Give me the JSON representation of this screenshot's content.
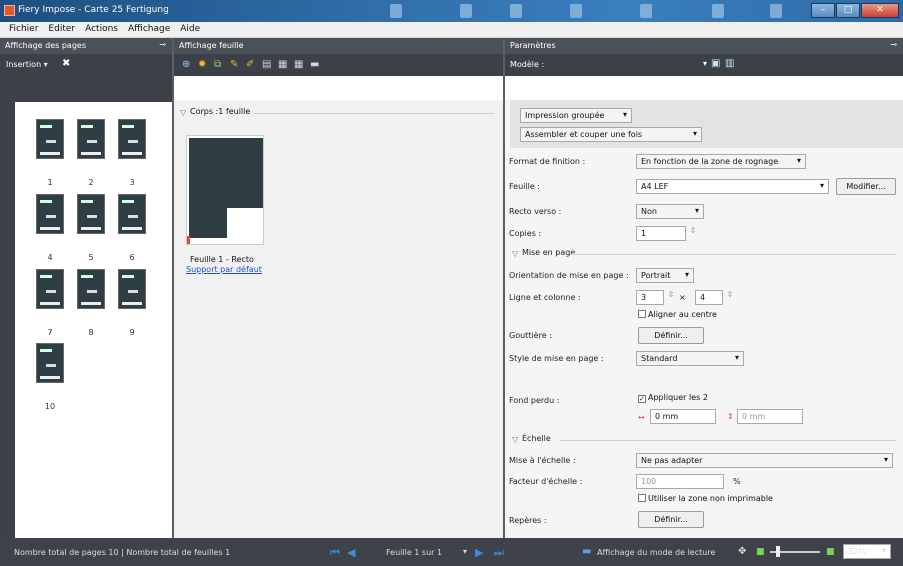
{
  "window": {
    "title": "Fiery Impose - Carte 25 Fertigung",
    "minimize": "–",
    "maximize": "□",
    "close": "✕"
  },
  "menu": [
    "Fichier",
    "Editer",
    "Actions",
    "Affichage",
    "Aide"
  ],
  "left_panel": {
    "title": "Affichage des pages",
    "toolbar_label": "Insertion ▾",
    "pages": [
      "1",
      "2",
      "3",
      "4",
      "5",
      "6",
      "7",
      "8",
      "9",
      "10"
    ]
  },
  "middle_panel": {
    "title": "Affichage feuille",
    "section": "Corps :1 feuille",
    "sheet_caption": "Feuille 1 - Recto",
    "sheet_link": "Support par défaut"
  },
  "right_panel": {
    "title": "Paramètres",
    "model_label": "Modèle :",
    "dd_impression": "Impression groupée",
    "dd_assembler": "Assembler et couper une fois",
    "labels": {
      "format_finition": "Format de finition :",
      "feuille": "Feuille :",
      "recto_verso": "Recto verso :",
      "copies": "Copies :",
      "orientation": "Orientation de mise en page :",
      "ligne_colonne": "Ligne et colonne :",
      "gouttiere": "Gouttière :",
      "style": "Style de mise en page :",
      "fond_perdu": "Fond perdu :",
      "mise_echelle": "Mise à l'échelle :",
      "facteur": "Facteur d'échelle :",
      "reperes": "Repères :"
    },
    "values": {
      "format_finition": "En fonction de la zone de rognage",
      "feuille": "A4 LEF",
      "recto_verso": "Non",
      "copies": "1",
      "orientation": "Portrait",
      "lignes": "3",
      "x": "×",
      "colonnes": "4",
      "style": "Standard",
      "fond_h": "0 mm",
      "fond_v": "0 mm",
      "mise_echelle": "Ne pas adapter",
      "facteur": "100",
      "percent": "%"
    },
    "sections": {
      "mise_en_page": "Mise en page",
      "echelle": "Échelle"
    },
    "buttons": {
      "modifier": "Modifier...",
      "definir1": "Définir...",
      "definir2": "Définir..."
    },
    "checks": {
      "aligner": "Aligner au centre",
      "appliquer": "Appliquer les 2",
      "zone": "Utiliser la zone non imprimable"
    }
  },
  "status": {
    "totals": "Nombre total de pages 10 | Nombre total de feuilles 1",
    "sheet_nav": "Feuille 1 sur 1",
    "reader_mode": "Affichage du mode de lecture",
    "zoom": "32%"
  }
}
